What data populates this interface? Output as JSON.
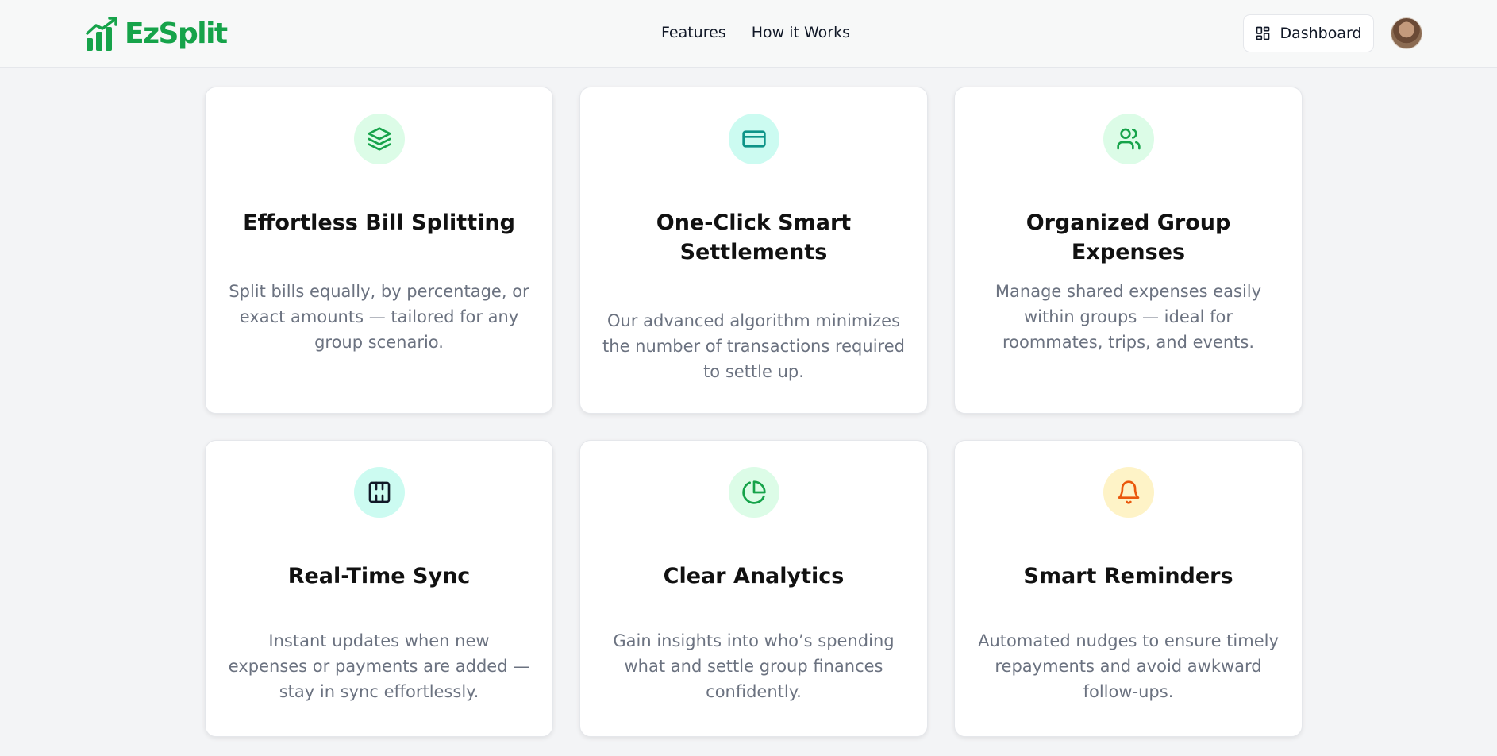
{
  "header": {
    "brand": "EzSplit",
    "nav": [
      "Features",
      "How it Works"
    ],
    "dashboard_label": "Dashboard",
    "brand_color": "#16a34a"
  },
  "features": [
    {
      "icon": "layers-icon",
      "title": "Effortless Bill Splitting",
      "description": "Split bills equally, by percentage, or exact amounts — tailored for any group scenario.",
      "icon_bg": "#dcfce7",
      "icon_color": "#16a34a"
    },
    {
      "icon": "credit-card-icon",
      "title": "One-Click Smart Settlements",
      "description": "Our advanced algorithm minimizes the number of transactions required to settle up.",
      "icon_bg": "#ccfbf1",
      "icon_color": "#0d9488"
    },
    {
      "icon": "users-icon",
      "title": "Organized Group Expenses",
      "description": "Manage shared expenses easily within groups — ideal for roommates, trips, and events.",
      "icon_bg": "#dcfce7",
      "icon_color": "#16a34a"
    },
    {
      "icon": "sync-icon",
      "title": "Real-Time Sync",
      "description": "Instant updates when new expenses or payments are added — stay in sync effortlessly.",
      "icon_bg": "#ccfbf1",
      "icon_color": "#111827"
    },
    {
      "icon": "pie-chart-icon",
      "title": "Clear Analytics",
      "description": "Gain insights into who’s spending what and settle group finances confidently.",
      "icon_bg": "#dcfce7",
      "icon_color": "#16a34a"
    },
    {
      "icon": "bell-icon",
      "title": "Smart Reminders",
      "description": "Automated nudges to ensure timely repayments and avoid awkward follow-ups.",
      "icon_bg": "#fef3c7",
      "icon_color": "#ea580c"
    }
  ]
}
